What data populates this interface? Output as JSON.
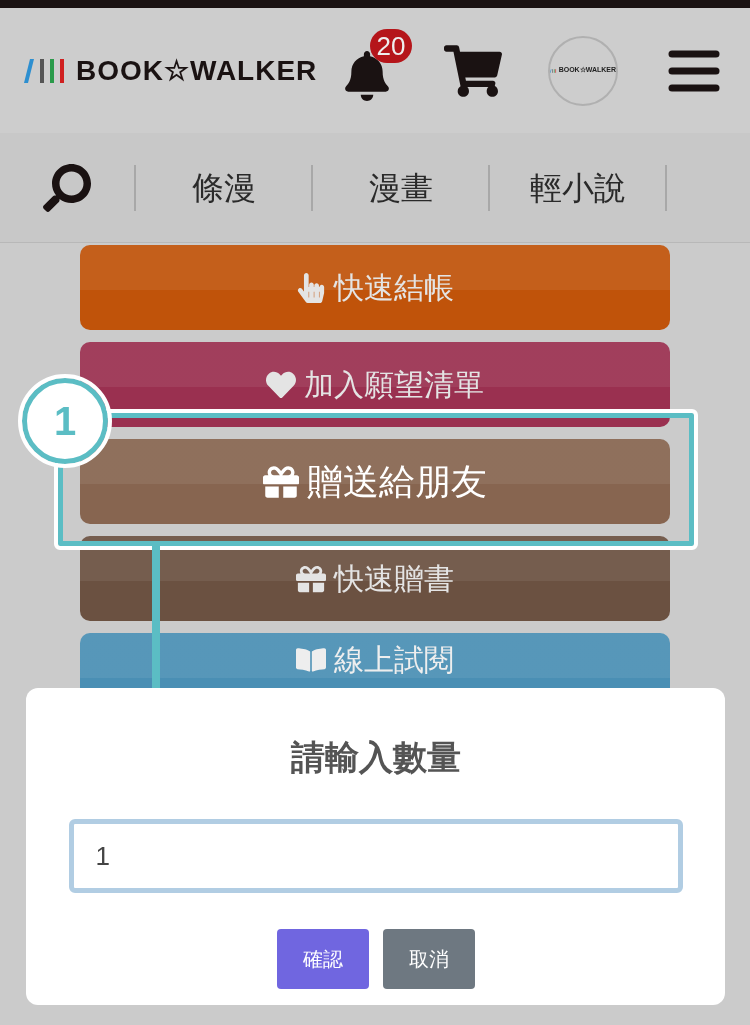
{
  "header": {
    "logo": "BOOK☆WALKER",
    "notification_count": "20",
    "avatar_logo": "BOOK☆WALKER"
  },
  "nav": {
    "items": [
      "條漫",
      "漫畫",
      "輕小說"
    ]
  },
  "actions": [
    {
      "kind": "checkout",
      "label": "快速結帳",
      "color": "#c0530a",
      "highlighted": false
    },
    {
      "kind": "wishlist",
      "label": "加入願望清單",
      "color": "#9a3050",
      "highlighted": false
    },
    {
      "kind": "gift",
      "label": "贈送給朋友",
      "color": "#876550",
      "highlighted": true
    },
    {
      "kind": "gift",
      "label": "快速贈書",
      "color": "#6b5141",
      "highlighted": false
    },
    {
      "kind": "preview",
      "label": "線上試閱",
      "color": "#4a8fb4",
      "highlighted": false
    }
  ],
  "annotation": {
    "step": "1"
  },
  "dialog": {
    "title": "請輸入數量",
    "value": "1",
    "buttons": [
      {
        "kind": "confirm",
        "label": "確認"
      },
      {
        "kind": "cancel",
        "label": "取消"
      }
    ]
  }
}
